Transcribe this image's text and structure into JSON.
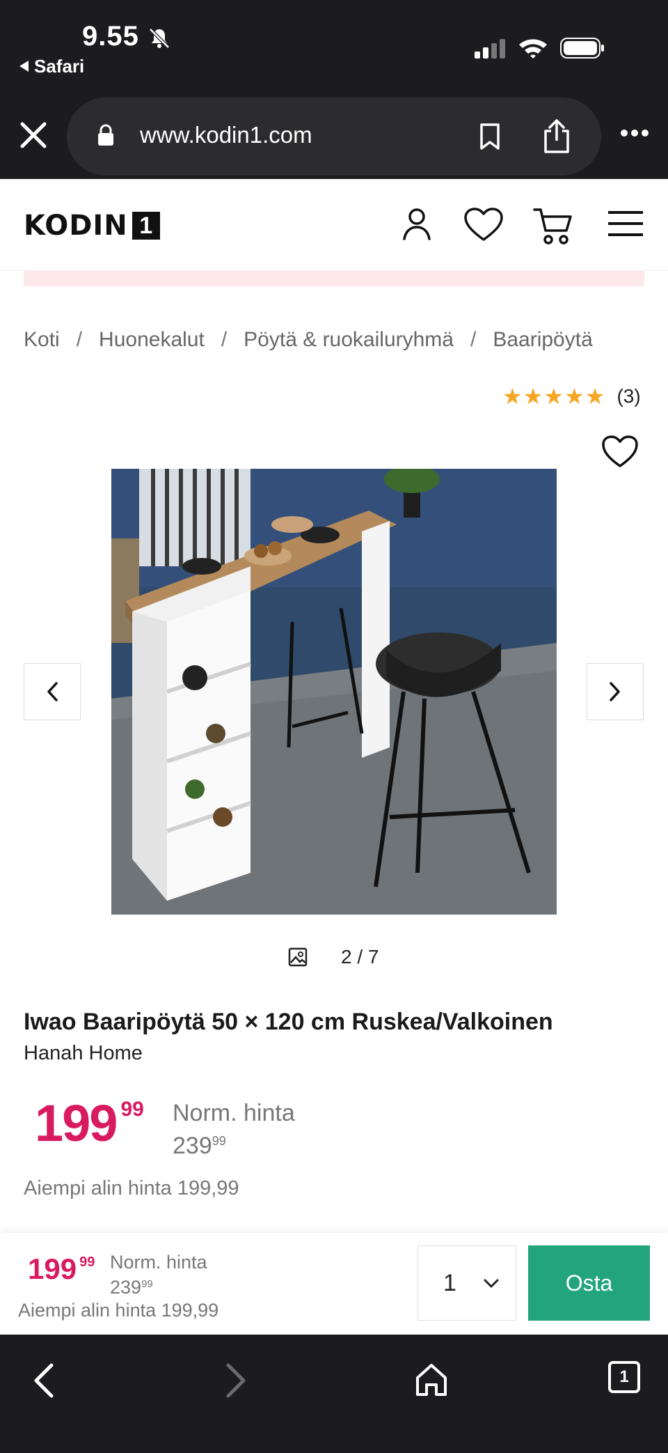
{
  "status": {
    "time": "9.55",
    "back_app": "Safari"
  },
  "browser": {
    "url": "www.kodin1.com",
    "tab_count": "1"
  },
  "site": {
    "logo_text": "KODIN",
    "logo_box": "1",
    "icons": [
      "user-icon",
      "heart-icon",
      "cart-icon",
      "menu-icon"
    ]
  },
  "breadcrumb": {
    "items": [
      "Koti",
      "Huonekalut",
      "Pöytä & ruokailuryhmä",
      "Baaripöytä"
    ],
    "separator": "/"
  },
  "rating": {
    "stars": "★★★★★",
    "value": 4.5,
    "count": "(3)"
  },
  "gallery": {
    "counter": "2 / 7"
  },
  "product": {
    "title": "Iwao Baaripöytä 50 × 120 cm Ruskea/Valkoinen",
    "brand": "Hanah Home",
    "price_int": "199",
    "price_dec": "99",
    "norm_label": "Norm. hinta",
    "norm_int": "239",
    "norm_dec": "99",
    "lowest_label": "Aiempi alin hinta 199,99"
  },
  "buybar": {
    "price_int": "199",
    "price_dec": "99",
    "norm_label": "Norm. hinta",
    "norm_int": "239",
    "norm_dec": "99",
    "lowest_label": "Aiempi alin hinta 199,99",
    "quantity": "1",
    "buy_label": "Osta"
  },
  "colors": {
    "price": "#d81b60",
    "buy": "#23a57b",
    "star": "#f5a623",
    "chrome": "#1c1c1e"
  }
}
